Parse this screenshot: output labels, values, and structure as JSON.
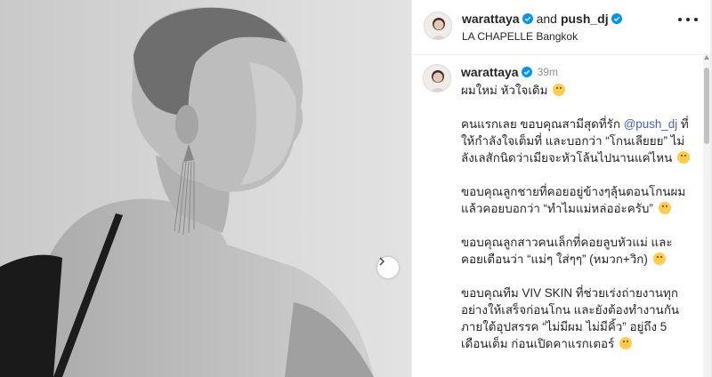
{
  "header": {
    "user1": "warattaya",
    "and_text": "and",
    "user2": "push_dj",
    "location": "LA CHAPELLE Bangkok"
  },
  "caption": {
    "username": "warattaya",
    "time": "39m",
    "paragraphs": [
      {
        "text": "ผมใหม่ หัวใจเดิม",
        "emoji": "grinning-face"
      },
      {
        "before": "คนแรกเลย ขอบคุณสามีสุดที่รัก ",
        "mention": "@push_dj",
        "after": " ที่ให้กำลังใจเต็มที่ และบอกว่า “โกนเลียยย” ไม่ลังเลสักนิดว่าเมียจะหัวโล้นไปนานแค่ไหน",
        "emoji": "face-blowing-kiss"
      },
      {
        "text": "ขอบคุณลูกชายที่คอยอยู่ข้างๆลุ้นตอนโกนผม แล้วคอยบอกว่า “ทำไมแม่หล่ออ่ะครับ”",
        "emoji": "beaming-face"
      },
      {
        "text": "ขอบคุณลูกสาวคนเล็กที่คอยลูบหัวแม่ และคอยเตือนว่า “แม่ๆ ใส่ๆๆ” (หมวก+วิก)",
        "emoji": "rolling-laughing-face"
      },
      {
        "text": "ขอบคุณทีม VIV SKIN ที่ช่วยเร่งถ่ายงานทุกอย่างให้เสร็จก่อนโกน และยังต้องทำงานกันภายใต้อุปสรรค “ไม่มีผม ไม่มีคิ้ว” อยู่ถึง 5 เดือนเต็ม ก่อนเปิดคาแรกเตอร์",
        "emoji": "smiling-face-with-hearts"
      }
    ]
  },
  "colors": {
    "verified": "#0095f6",
    "mention": "#4a5fc1",
    "time": "#8e8e8e",
    "emoji": "#ffcc4d"
  },
  "icons": {
    "more": "more-horizontal-icon",
    "next": "chevron-right-icon",
    "verified": "verified-badge-icon"
  }
}
